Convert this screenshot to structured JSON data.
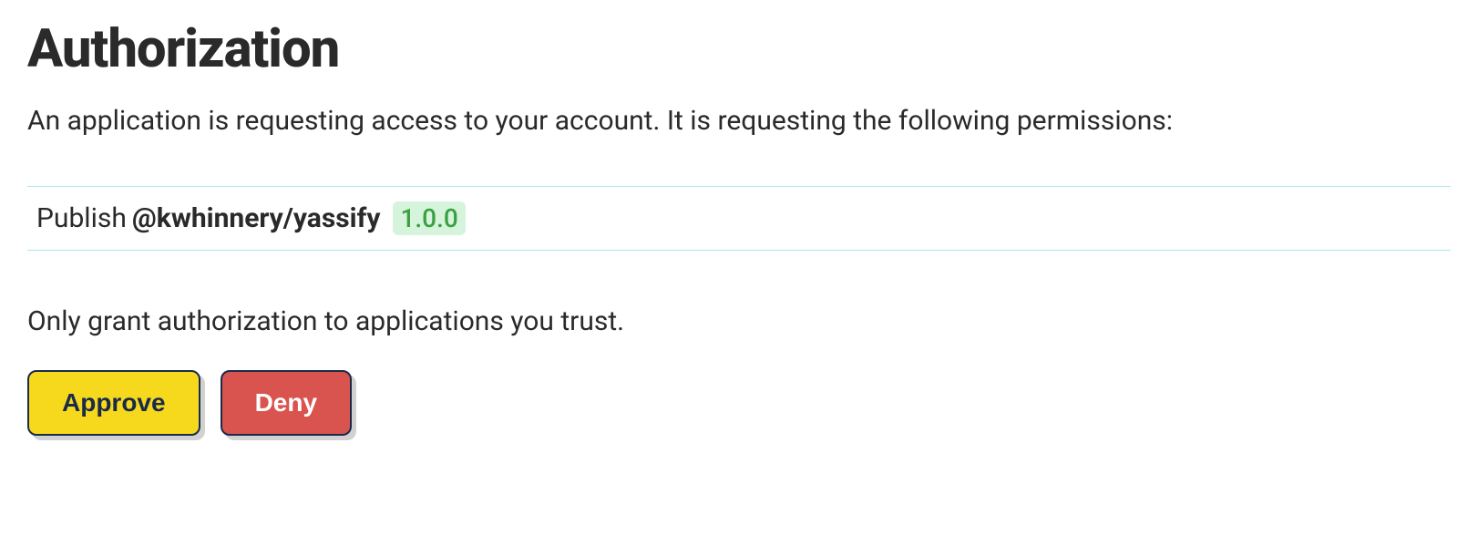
{
  "title": "Authorization",
  "description": "An application is requesting access to your account. It is requesting the following permissions:",
  "permission": {
    "action": "Publish ",
    "package": "@kwhinnery/yassify",
    "version": "1.0.0"
  },
  "warning": "Only grant authorization to applications you trust.",
  "buttons": {
    "approve": "Approve",
    "deny": "Deny"
  }
}
